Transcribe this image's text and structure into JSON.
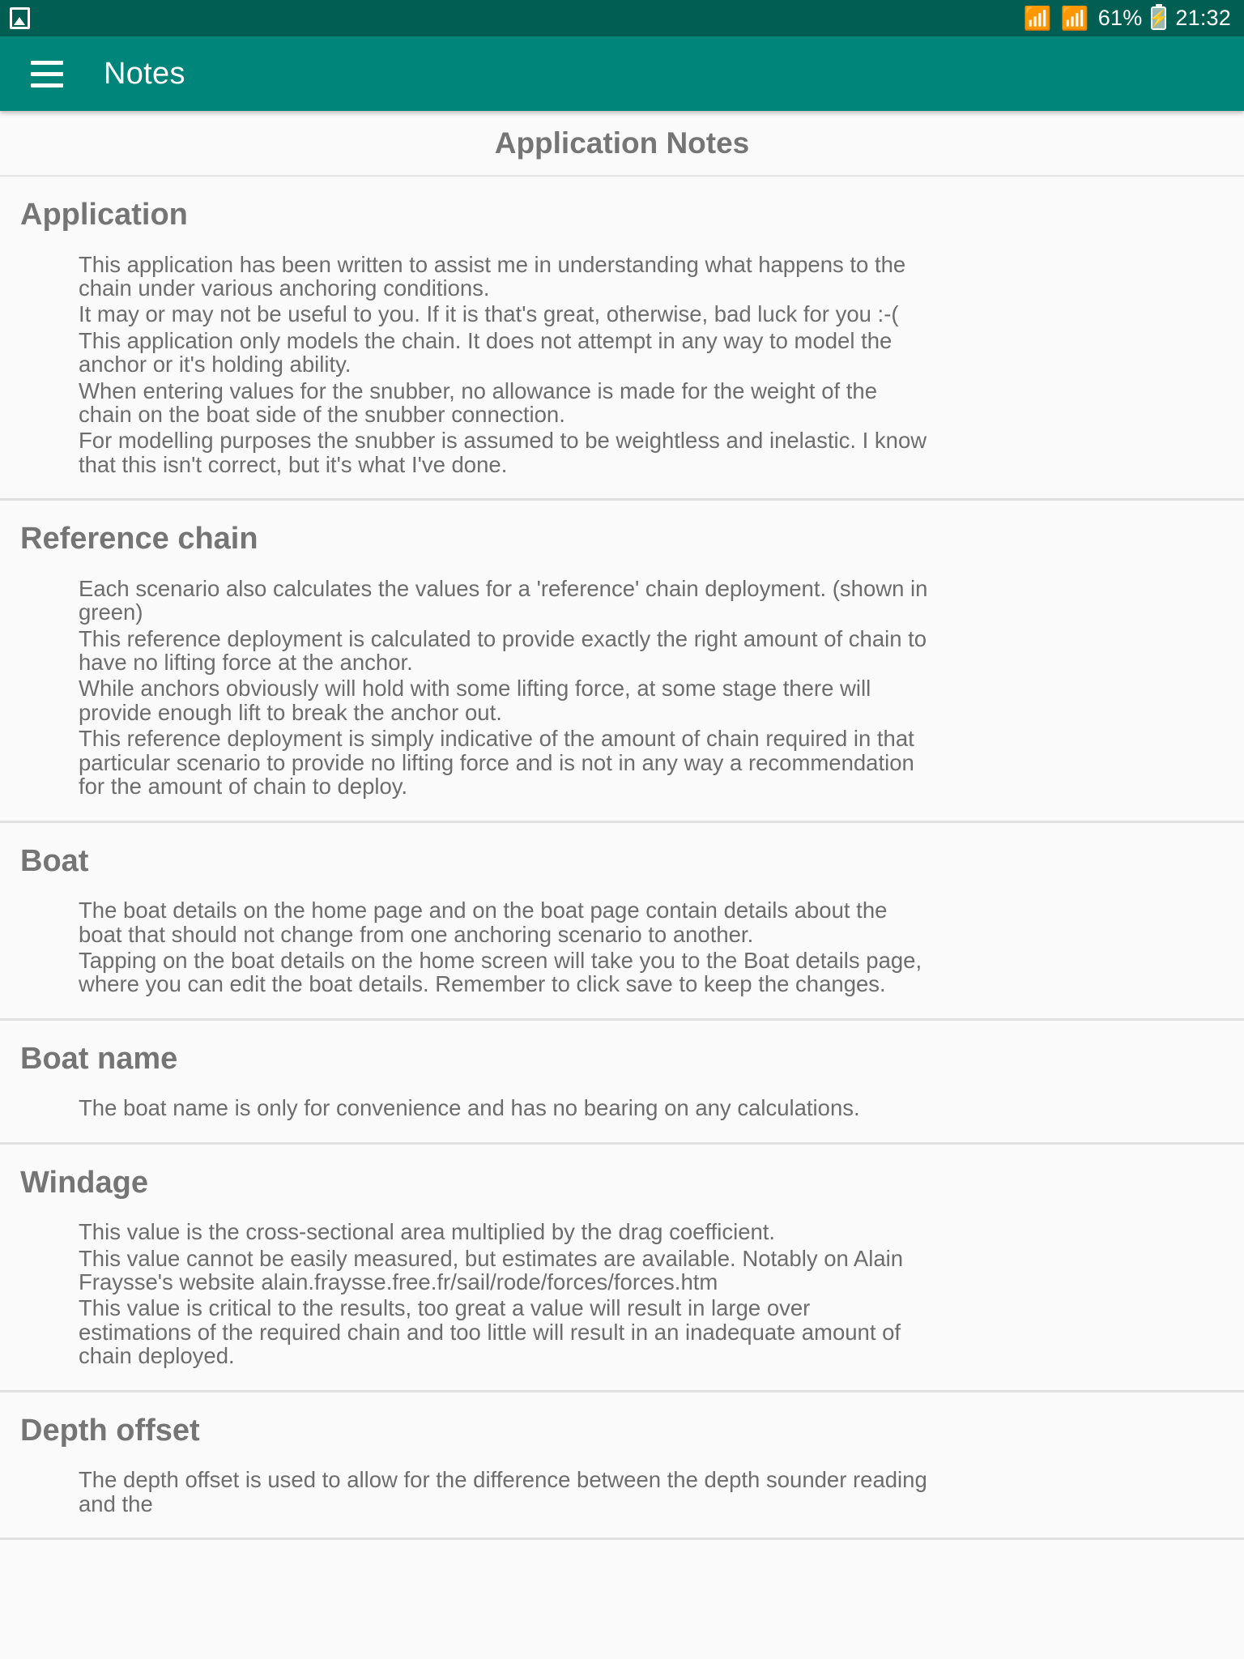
{
  "status_bar": {
    "left_icon": "photo-icon",
    "bluetooth_icon": "bluetooth-icon",
    "wifi_icon": "wifi-icon",
    "battery_percent": "61%",
    "battery_icon": "battery-charging-icon",
    "clock": "21:32"
  },
  "app_bar": {
    "menu_icon": "hamburger-menu-icon",
    "title": "Notes"
  },
  "page": {
    "heading": "Application Notes"
  },
  "sections": [
    {
      "title": "Application",
      "lines": [
        "This application has been written to assist me in understanding what happens to the chain under various anchoring conditions.",
        "It may or may not be useful to you. If it is that's great, otherwise, bad luck for you :-(",
        "This application only models the chain. It does not attempt in any way to model the anchor or it's holding ability.",
        "When entering values for the snubber, no allowance is made for the weight of the chain on the boat side of the snubber connection.",
        "For modelling purposes the snubber is assumed to be weightless and inelastic. I know that this isn't correct, but it's what I've done."
      ]
    },
    {
      "title": "Reference chain",
      "lines": [
        "Each scenario also calculates the values for a 'reference' chain deployment. (shown in green)",
        "This reference deployment is calculated to provide exactly the right amount of chain to have no lifting force at the anchor.",
        "While anchors obviously will hold with some lifting force, at some stage there will provide enough lift to break the anchor out.",
        "This reference deployment is simply indicative of the amount of chain required in that particular scenario to provide no lifting force and is not in any way a recommendation for the amount of chain to deploy."
      ]
    },
    {
      "title": "Boat",
      "lines": [
        "The boat details on the home page and on the boat page contain details about the boat that should not change from one anchoring scenario to another.",
        "Tapping on the boat details on the home screen will take you to the Boat details page, where you can edit the boat details. Remember to click save to keep the changes."
      ]
    },
    {
      "title": "Boat name",
      "lines": [
        "The boat name is only for convenience and has no bearing on any calculations."
      ]
    },
    {
      "title": "Windage",
      "lines": [
        "This value is the cross-sectional area multiplied by the drag coefficient.",
        "This value cannot be easily measured, but estimates are available. Notably on Alain Fraysse's website alain.fraysse.free.fr/sail/rode/forces/forces.htm",
        "This value is critical to the results, too great a value will result in large over estimations of the required chain and too little will result in an inadequate amount of chain deployed."
      ]
    },
    {
      "title": "Depth offset",
      "lines": [
        "The depth offset is used to allow for the difference between the depth sounder reading and the"
      ]
    }
  ],
  "colors": {
    "status_bar_bg": "#005f52",
    "app_bar_bg": "#00857a",
    "page_bg": "#fafafa",
    "heading_text": "#757575",
    "body_text": "#6d6d6d",
    "divider": "#e0e0e0"
  }
}
